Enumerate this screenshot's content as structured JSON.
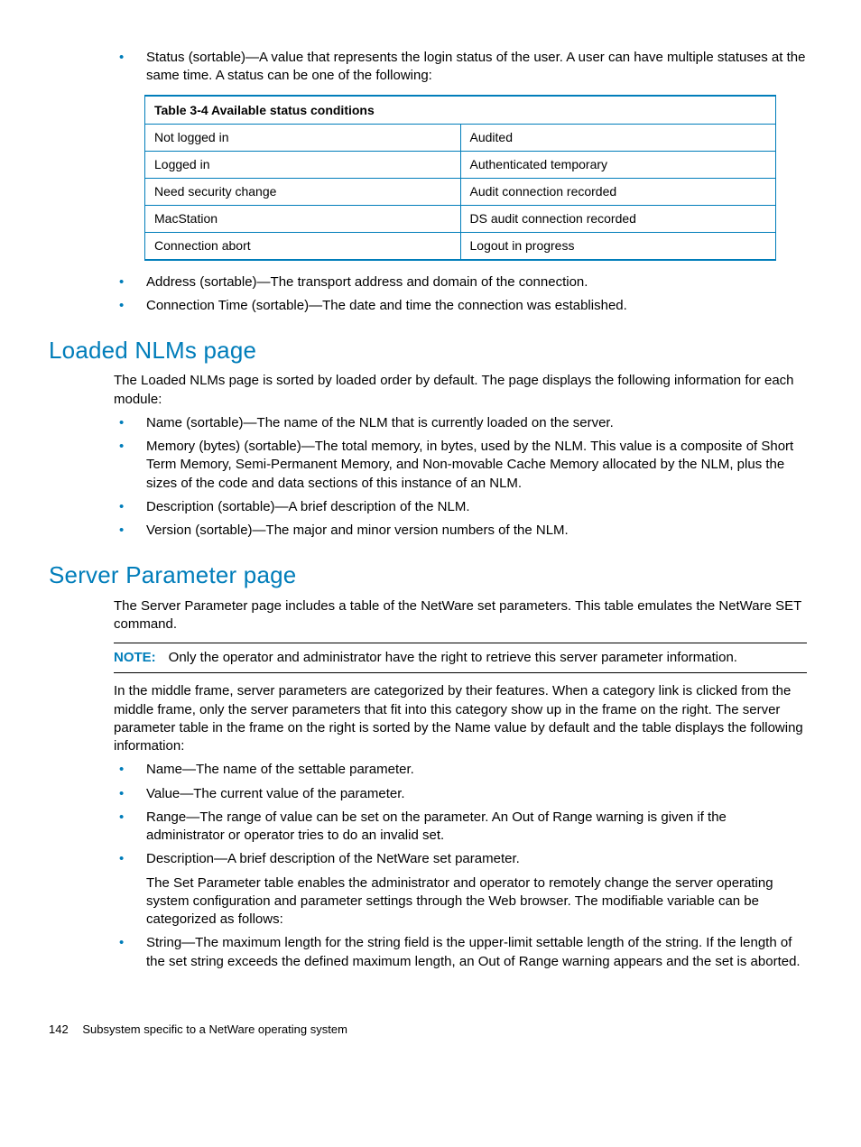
{
  "intro_bullets": [
    "Status (sortable)—A value that represents the login status of the user. A user can have multiple statuses at the same time. A status can be one of the following:"
  ],
  "table": {
    "caption": "Table 3-4  Available status conditions",
    "rows": [
      [
        "Not logged in",
        "Audited"
      ],
      [
        "Logged in",
        "Authenticated temporary"
      ],
      [
        "Need security change",
        "Audit connection recorded"
      ],
      [
        "MacStation",
        "DS audit connection recorded"
      ],
      [
        "Connection abort",
        "Logout in progress"
      ]
    ]
  },
  "after_table_bullets": [
    "Address (sortable)—The transport address and domain of the connection.",
    "Connection Time (sortable)—The date and time the connection was established."
  ],
  "section1": {
    "heading": "Loaded NLMs page",
    "intro": "The Loaded NLMs page is sorted by loaded order by default. The page displays the following information for each module:",
    "bullets": [
      "Name (sortable)—The name of the NLM that is currently loaded on the server.",
      "Memory (bytes) (sortable)—The total memory, in bytes, used by the NLM. This value is a composite of Short Term Memory, Semi-Permanent Memory, and Non-movable Cache Memory allocated by the NLM, plus the sizes of the code and data sections of this instance of an NLM.",
      "Description (sortable)—A brief description of the NLM.",
      "Version (sortable)—The major and minor version numbers of the NLM."
    ]
  },
  "section2": {
    "heading": "Server Parameter page",
    "intro": "The Server Parameter page includes a table of the NetWare set parameters. This table emulates the NetWare SET command.",
    "note_label": "NOTE:",
    "note_text": "Only the operator and administrator have the right to retrieve this server parameter information.",
    "after_note": "In the middle frame, server parameters are categorized by their features. When a category link is clicked from the middle frame, only the server parameters that fit into this category show up in the frame on the right. The server parameter table in the frame on the right is sorted by the Name value by default and the table displays the following information:",
    "bullets": [
      {
        "text": "Name—The name of the settable parameter."
      },
      {
        "text": "Value—The current value of the parameter."
      },
      {
        "text": "Range—The range of value can be set on the parameter. An Out of Range warning is given if the administrator or operator tries to do an invalid set."
      },
      {
        "text": "Description—A brief description of the NetWare set parameter.",
        "after": "The Set Parameter table enables the administrator and operator to remotely change the server operating system configuration and parameter settings through the Web browser. The modifiable variable can be categorized as follows:"
      },
      {
        "text": "String—The maximum length for the string field is the upper-limit settable length of the string. If the length of the set string exceeds the defined maximum length, an Out of Range warning appears and the set is aborted."
      }
    ]
  },
  "footer": {
    "page": "142",
    "title": "Subsystem specific to a NetWare operating system"
  }
}
